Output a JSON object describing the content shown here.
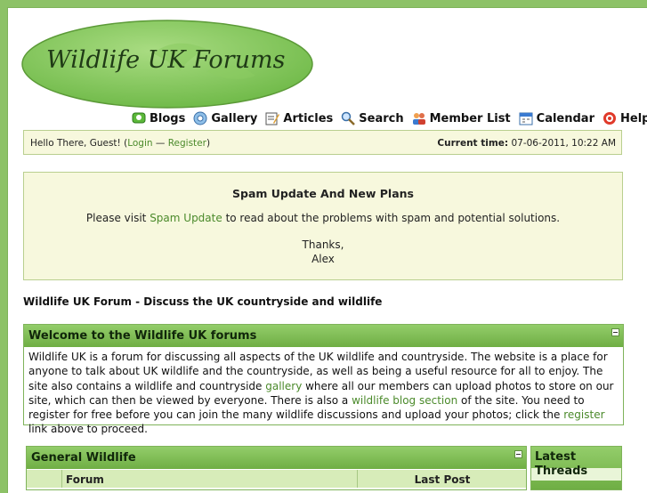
{
  "logo": {
    "text": "Wildlife UK Forums"
  },
  "menu": [
    {
      "label": "Blogs",
      "icon": "blogs-icon"
    },
    {
      "label": "Gallery",
      "icon": "gallery-icon"
    },
    {
      "label": "Articles",
      "icon": "articles-icon"
    },
    {
      "label": "Search",
      "icon": "search-icon"
    },
    {
      "label": "Member List",
      "icon": "member-list-icon"
    },
    {
      "label": "Calendar",
      "icon": "calendar-icon"
    },
    {
      "label": "Help",
      "icon": "help-icon"
    }
  ],
  "welcome": {
    "greeting": "Hello There, Guest! (",
    "login": "Login",
    "sep": " — ",
    "register": "Register",
    "close": ")",
    "time_label": "Current time:",
    "time_value": " 07-06-2011, 10:22 AM"
  },
  "notice": {
    "title": "Spam Update And New Plans",
    "pre": "Please visit ",
    "link": "Spam Update",
    "post": " to read about the problems with spam and potential solutions.",
    "thanks": "Thanks,",
    "sign": "Alex"
  },
  "page_heading": "Wildlife UK Forum - Discuss the UK countryside and wildlife",
  "intro": {
    "title": "Welcome to the Wildlife UK forums",
    "t1": "Wildlife UK is a forum for discussing all aspects of the UK wildlife and countryside. The website is a place for anyone to talk about UK wildlife and the countryside, as well as being a useful resource for all to enjoy. The site also contains a wildlife and countryside ",
    "gallery_link": "gallery",
    "t2": " where all our members can upload photos to store on our site, which can then be viewed by everyone. There is also a ",
    "blog_link": "wildlife blog section",
    "t3": " of the site. You need to register for free before you can join the many wildlife discussions and upload your photos; click the ",
    "register_link": "register",
    "t4": " link above to proceed."
  },
  "forum_section": {
    "title": "General Wildlife",
    "col_forum": "Forum",
    "col_last": "Last Post"
  },
  "latest": {
    "title": "Latest Threads"
  },
  "colors": {
    "accent": "#6fae44",
    "link": "#4b8a2b",
    "notice_bg": "#f7f8dd"
  }
}
